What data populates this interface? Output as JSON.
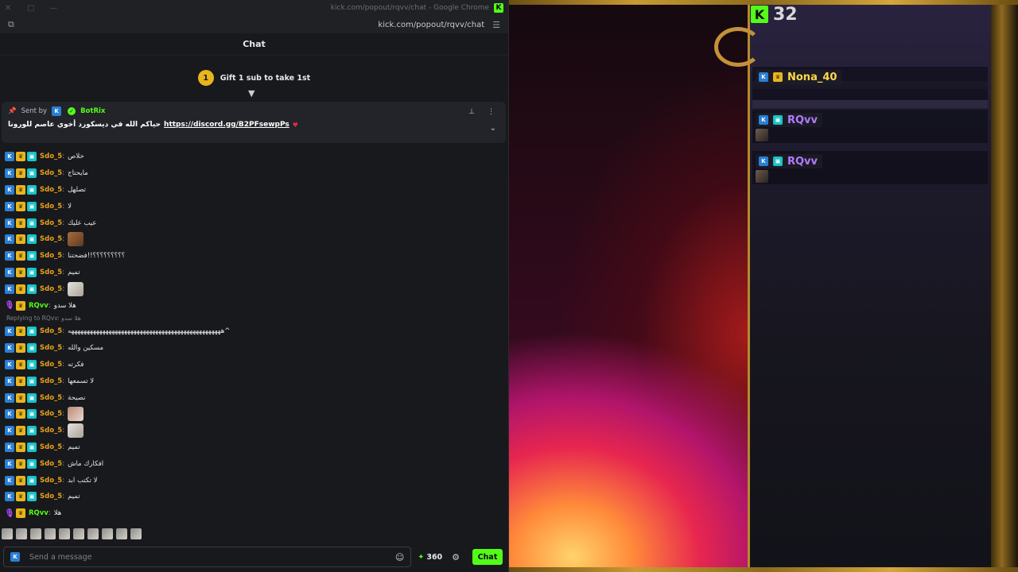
{
  "browser": {
    "window_title": "kick.com/popout/rqvv/chat - Google Chrome",
    "url": "kick.com/popout/rqvv/chat"
  },
  "chat": {
    "header": "Chat",
    "gift": {
      "number": "1",
      "label": "Gift 1 sub to take 1st"
    },
    "pinned": {
      "sent_by_label": "Sent by",
      "bot_name": "BotRix",
      "text": "حياكم الله في ديسكورد أخوي عاصم للورونا",
      "link": "https://discord.gg/B2PFsewpPs"
    },
    "messages": [
      {
        "user": "Sdo_5",
        "text": "خلاص"
      },
      {
        "user": "Sdo_5",
        "text": "مايحتاج"
      },
      {
        "user": "Sdo_5",
        "text": "تصلهل"
      },
      {
        "user": "Sdo_5",
        "text": "لا"
      },
      {
        "user": "Sdo_5",
        "text": "عيب عليك"
      },
      {
        "user": "Sdo_5",
        "text": "",
        "emote": "brown"
      },
      {
        "user": "Sdo_5",
        "text": "؟؟؟؟؟؟؟؟؟!!فضحتنا"
      },
      {
        "user": "Sdo_5",
        "text": "تميم"
      },
      {
        "user": "Sdo_5",
        "text": "",
        "emote": "pale"
      },
      {
        "user": "RQvv",
        "text": "هلا سدو",
        "mod": true
      },
      {
        "reply": "Replying to RQvv: هلا سدو"
      },
      {
        "user": "Sdo_5",
        "text": "هههههههههههههههههههههههههههههههههههههههههههههههههه^"
      },
      {
        "user": "Sdo_5",
        "text": "مسكين والله"
      },
      {
        "user": "Sdo_5",
        "text": "فكرته"
      },
      {
        "user": "Sdo_5",
        "text": "لا تسمعها"
      },
      {
        "user": "Sdo_5",
        "text": "نصيحة"
      },
      {
        "user": "Sdo_5",
        "text": "",
        "emote": "mix"
      },
      {
        "user": "Sdo_5",
        "text": "",
        "emote": "pale"
      },
      {
        "user": "Sdo_5",
        "text": "تميم"
      },
      {
        "user": "Sdo_5",
        "text": "افكارك ماش"
      },
      {
        "user": "Sdo_5",
        "text": "لا تكتب ابد"
      },
      {
        "user": "Sdo_5",
        "text": "تميم"
      },
      {
        "user": "RQvv",
        "text": "هلا",
        "mod": true
      }
    ],
    "composer": {
      "placeholder": "Send a message",
      "points": "360",
      "send_label": "Chat"
    }
  },
  "stream": {
    "viewer_count": "32",
    "overlay_messages": [
      {
        "name": "Nona_40",
        "color": "#ffd84a"
      },
      {
        "name": "RQvv",
        "color": "#b27bff"
      },
      {
        "name": "RQvv",
        "color": "#b27bff"
      }
    ]
  },
  "colors": {
    "accent": "#53fc18",
    "sub_user": "#e8a21a",
    "mod_user": "#53fc18"
  }
}
